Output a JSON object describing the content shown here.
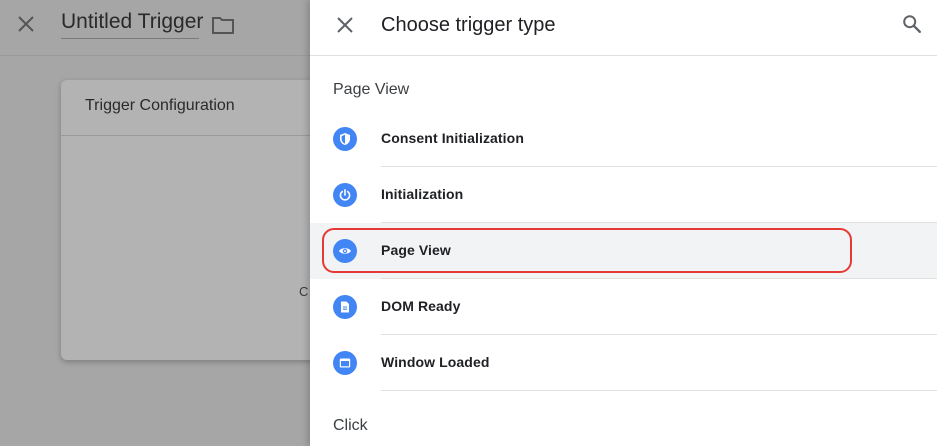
{
  "background": {
    "trigger_name": "Untitled Trigger",
    "card_title": "Trigger Configuration",
    "card_fragment": "C"
  },
  "panel": {
    "title": "Choose trigger type",
    "sections": [
      {
        "label": "Page View",
        "items": [
          {
            "label": "Consent Initialization",
            "icon": "shield-icon"
          },
          {
            "label": "Initialization",
            "icon": "power-icon"
          },
          {
            "label": "Page View",
            "icon": "eye-icon",
            "highlighted": true
          },
          {
            "label": "DOM Ready",
            "icon": "document-icon"
          },
          {
            "label": "Window Loaded",
            "icon": "window-icon"
          }
        ]
      },
      {
        "label": "Click",
        "items": []
      }
    ]
  },
  "colors": {
    "icon_blue": "#4285f4",
    "highlight_outline": "#e53935",
    "highlight_row": "#f1f3f4"
  }
}
